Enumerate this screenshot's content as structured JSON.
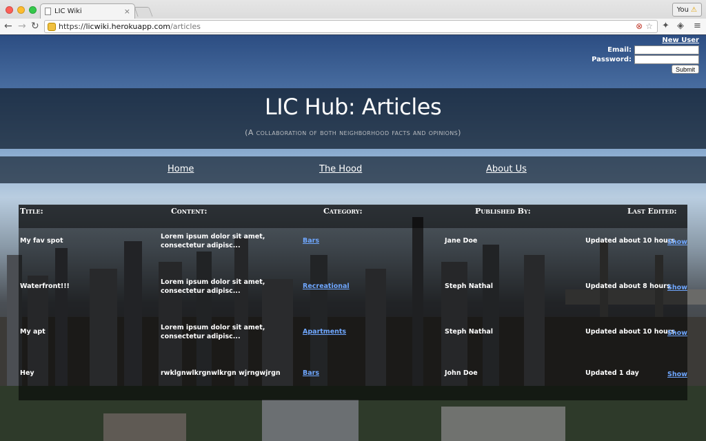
{
  "browser": {
    "tab_title": "LIC Wiki",
    "tab_close": "×",
    "profile_label": "You",
    "profile_warning": "⚠",
    "url_scheme": "https://",
    "url_host": "licwiki.herokuapp.com",
    "url_path": "/articles",
    "back": "←",
    "forward": "→",
    "reload": "↻",
    "blocked_icon": "⊗",
    "star_icon": "☆",
    "extension_icon": "✦",
    "pocket_icon": "◈",
    "menu_icon": "≡"
  },
  "login": {
    "new_user": "New User",
    "email_label": "Email:",
    "password_label": "Password:",
    "email_value": "",
    "password_value": "",
    "submit_label": "Submit"
  },
  "header": {
    "title": "LIC Hub: Articles",
    "subtitle": "(A collaboration of both neighborhood facts and opinions)"
  },
  "nav": {
    "home": "Home",
    "hood": "The Hood",
    "about": "About Us"
  },
  "table": {
    "headers": {
      "title": "Title:",
      "content": "Content:",
      "category": "Category:",
      "published_by": "Published By:",
      "last_edited": "Last Edited:"
    },
    "show_label": "Show",
    "rows": [
      {
        "title": "My fav spot",
        "content": "Lorem ipsum dolor sit amet, consectetur adipisc...",
        "category": "Bars",
        "author": "Jane Doe",
        "updated": "Updated about 10 hours"
      },
      {
        "title": "Waterfront!!!",
        "content": "Lorem ipsum dolor sit amet, consectetur adipisc...",
        "category": "Recreational",
        "author": "Steph Nathal",
        "updated": "Updated about 8 hours"
      },
      {
        "title": "My apt",
        "content": "Lorem ipsum dolor sit amet, consectetur adipisc...",
        "category": "Apartments",
        "author": "Steph Nathal",
        "updated": "Updated about 10 hours"
      },
      {
        "title": "Hey",
        "content": "rwklgnwlkrgnwlkrgn wjrngwjrgn",
        "category": "Bars",
        "author": "John Doe",
        "updated": "Updated 1 day"
      }
    ]
  }
}
